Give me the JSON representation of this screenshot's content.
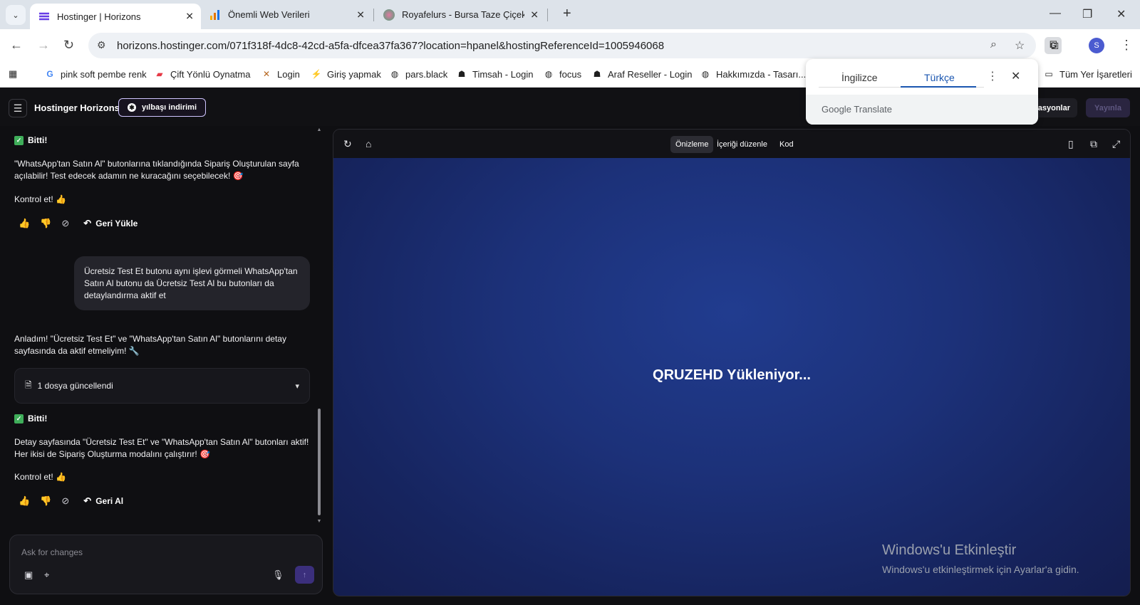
{
  "browser": {
    "tabs": [
      {
        "title": "Hostinger | Horizons",
        "active": true
      },
      {
        "title": "Önemli Web Verileri",
        "active": false
      },
      {
        "title": "Royafelurs - Bursa Taze Çiçek &",
        "active": false
      }
    ],
    "url": "horizons.hostinger.com/071f318f-4dc8-42cd-a5fa-dfcea37fa367?location=hpanel&hostingReferenceId=1005946068",
    "profile_initial": "S",
    "bookmarks": [
      "pink soft pembe renk",
      "Çift Yönlü Oynatma",
      "Login",
      "Giriş yapmak",
      "pars.black",
      "Timsah - Login",
      "focus",
      "Araf Reseller - Login",
      "Hakkımızda - Tasarı..."
    ],
    "all_bookmarks": "Tüm Yer İşaretleri"
  },
  "translate_popup": {
    "source_lang": "İngilizce",
    "target_lang": "Türkçe",
    "brand_google": "Google",
    "brand_translate": "Translate"
  },
  "app": {
    "brand": "Hostinger Horizons",
    "promo": "yılbaşı indirimi",
    "integrations_label": "grasyonlar",
    "publish_label": "Yayınla"
  },
  "chat": {
    "msg1_done": "Bitti!",
    "msg1_line1": "\"WhatsApp'tan Satın Al\" butonlarına tıklandığında Sipariş Oluşturulan sayfa",
    "msg1_line2": "açılabilir! Test edecek adamın ne kuracağını seçebilecek! 🎯",
    "msg1_check": "Kontrol et! 👍",
    "restore_label_1": "Geri Yükle",
    "user_line1": "Ücretsiz Test Et butonu aynı işlevi görmeli WhatsApp'tan",
    "user_line2": "Satın Al butonu da Ücretsiz Test Al bu butonları da",
    "user_line3": "detaylandırma aktif et",
    "msg2_line1": "Anladım! \"Ücretsiz Test Et\" ve \"WhatsApp'tan Satın Al\" butonlarını detay",
    "msg2_line2": "sayfasında da aktif etmeliyim! 🔧",
    "files_updated": "1 dosya güncellendi",
    "msg3_done": "Bitti!",
    "msg3_line1": "Detay sayfasında \"Ücretsiz Test Et\" ve \"WhatsApp'tan Satın Al\" butonları aktif!",
    "msg3_line2": "Her ikisi de Sipariş Oluşturma modalını çalıştırır! 🎯",
    "msg3_check": "Kontrol et! 👍",
    "restore_label_2": "Geri Al",
    "composer_placeholder": "Ask for changes"
  },
  "preview": {
    "tabs": [
      "Önizleme",
      "İçeriği düzenle",
      "Kod"
    ],
    "selected_tab": "Önizleme",
    "loading_text": "QRUZEHD Yükleniyor..."
  },
  "windows_watermark": {
    "title": "Windows'u Etkinleştir",
    "subtitle": "Windows'u etkinleştirmek için Ayarlar'a gidin."
  },
  "colors": {
    "accent": "#673de6",
    "stage_bg": "#1c3179",
    "chat_bg": "#0f0f12"
  }
}
